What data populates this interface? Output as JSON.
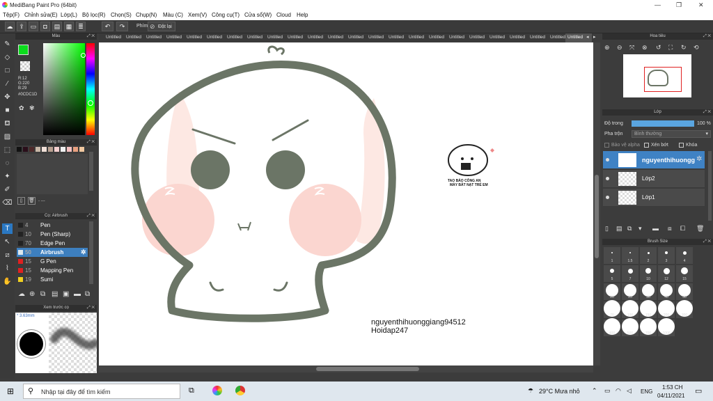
{
  "app": {
    "title": "MediBang Paint Pro (64bit)"
  },
  "menu": [
    "Tệp(F)",
    "Chỉnh sửa(E)",
    "Lớp(L)",
    "Bộ lọc(R)",
    "Chọn(S)",
    "Chụp(N)",
    "Màu (C)",
    "Xem(V)",
    "Công cụ(T)",
    "Cửa sổ(W)",
    "Cloud",
    "Help"
  ],
  "toolbar": {
    "key_label": "Phím",
    "reset_label": "Đặt lại"
  },
  "color_panel": {
    "title": "Màu",
    "rgb": [
      "R:12",
      "G:220",
      "B:29"
    ],
    "hex": "#0CDC1D",
    "fg_color": "#0cdc1d",
    "bg_color": "#ffffff"
  },
  "palette": {
    "title": "Bảng màu",
    "dash": "- ---",
    "swatches": [
      "#111111",
      "#2a0e1a",
      "#4d2a2a",
      "#c8b8a8",
      "#f0e0d8",
      "#b8a090",
      "#f4d0d0",
      "#f0f0f0",
      "#f4c0c0",
      "#e8a080",
      "#f0c8a0"
    ]
  },
  "brush_panel": {
    "title": "Cọ: Airbrush",
    "items": [
      {
        "size": "4",
        "name": "Pen",
        "color": "#222222"
      },
      {
        "size": "10",
        "name": "Pen (Sharp)",
        "color": "#222222"
      },
      {
        "size": "70",
        "name": "Edge Pen",
        "color": "#222222"
      },
      {
        "size": "50",
        "name": "Airbrush",
        "color": "#dde8ee",
        "selected": true
      },
      {
        "size": "15",
        "name": "G Pen",
        "color": "#e02020"
      },
      {
        "size": "15",
        "name": "Mapping Pen",
        "color": "#e02020"
      },
      {
        "size": "19",
        "name": "Sumi",
        "color": "#f0d020"
      }
    ]
  },
  "preview_panel": {
    "title": "Xem trước cọ",
    "size": "* 3.63mm"
  },
  "tabs": [
    "Untitled",
    "Untitled",
    "Untitled",
    "Untitled",
    "Untitled",
    "Untitled",
    "Untitled",
    "Untitled",
    "Untitled",
    "Untitled",
    "Untitled",
    "Untitled",
    "Untitled",
    "Untitled",
    "Untitled",
    "Untitled",
    "Untitled",
    "Untitled",
    "Untitled",
    "Untitled",
    "Untitled",
    "Untitled",
    "Untitled",
    "Untitled"
  ],
  "canvas": {
    "line_color": "#6b7566",
    "sticker_lines": [
      "TAO BÁO CÔNG AN",
      "MÀY BẮT NẠT TRẺ EM"
    ],
    "watermark_line1": "nguyenthihuonggiang94512",
    "watermark_line2": "Hoidap247"
  },
  "navigator": {
    "title": "Hoa tiêu"
  },
  "layers": {
    "title": "Lớp",
    "opacity_label": "Độ trong",
    "opacity_value": "100 %",
    "opacity_fraction": 1.0,
    "blend_label": "Pha trộn",
    "blend_value": "Bình thường",
    "alpha_label": "Bảo vệ alpha",
    "clip_label": "Xén bớt",
    "lock_label": "Khóa",
    "items": [
      {
        "name": "nguyenthihuongg",
        "selected": true
      },
      {
        "name": "Lớp2",
        "selected": false
      },
      {
        "name": "Lớp1",
        "selected": false
      }
    ]
  },
  "brush_size": {
    "title": "Brush Size",
    "sizes": [
      "1",
      "1.5",
      "2",
      "3",
      "4",
      "5",
      "7",
      "10",
      "12",
      "15",
      "20",
      "25",
      "30",
      "40",
      "50",
      "70",
      "100",
      "150",
      "200",
      "300",
      "400",
      "500",
      "700",
      "1000"
    ]
  },
  "taskbar": {
    "search_placeholder": "Nhập tại đây để tìm kiếm",
    "weather": "29°C  Mưa nhỏ",
    "lang": "ENG",
    "time": "1:53 CH",
    "date": "04/11/2021"
  }
}
